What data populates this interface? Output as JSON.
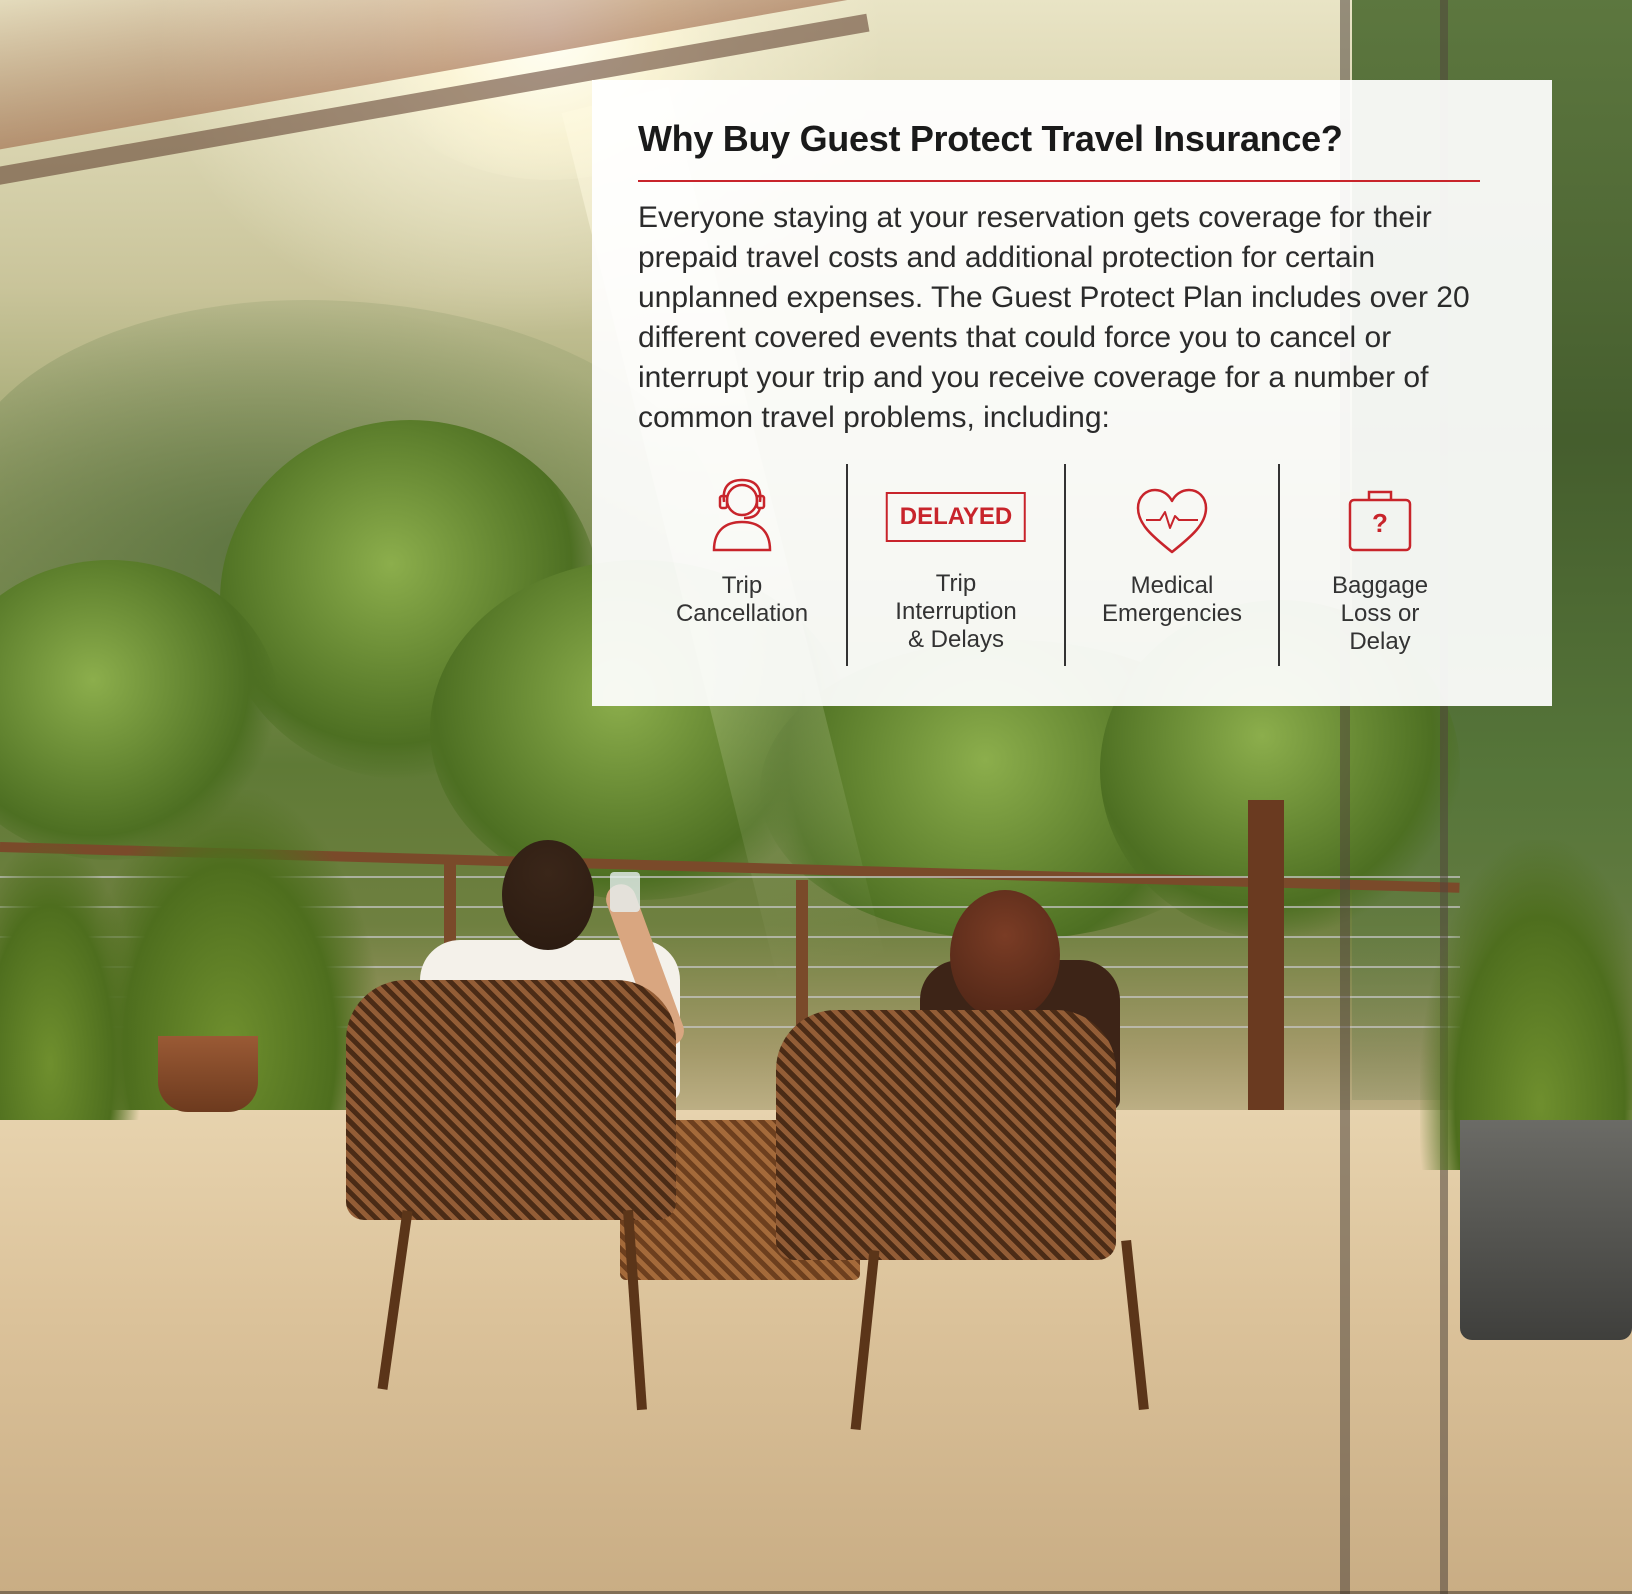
{
  "card": {
    "title": "Why Buy Guest Protect Travel Insurance?",
    "body": "Everyone staying at your reservation gets coverage for their prepaid travel costs and additional protection for certain unplanned expenses. The Guest Protect Plan includes over 20 different covered events that could force you to cancel or interrupt your trip and you receive coverage for a number of common travel problems, including:",
    "accent_color": "#c8242b"
  },
  "features": [
    {
      "icon": "headset-agent-icon",
      "label_lines": [
        "Trip",
        "Cancellation"
      ]
    },
    {
      "icon": "delayed-stamp-icon",
      "stamp_text": "DELAYED",
      "label_lines": [
        "Trip",
        "Interruption",
        "& Delays"
      ]
    },
    {
      "icon": "heart-pulse-icon",
      "label_lines": [
        "Medical",
        "Emergencies"
      ]
    },
    {
      "icon": "suitcase-question-icon",
      "icon_text": "?",
      "label_lines": [
        "Baggage",
        "Loss or",
        "Delay"
      ]
    }
  ]
}
